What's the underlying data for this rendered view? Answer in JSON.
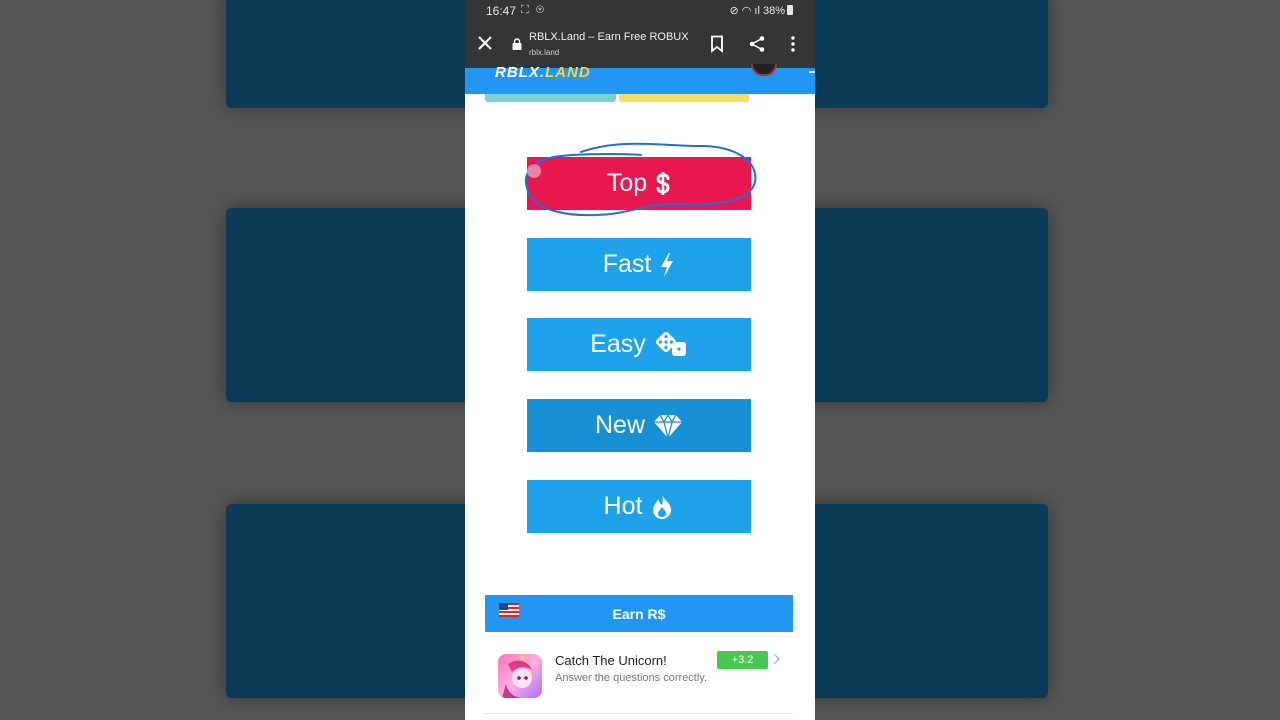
{
  "status_bar": {
    "time": "16:47",
    "notification_icons": "⛶ ⊛",
    "system": "⊘ ◠ ıl 38%"
  },
  "browser": {
    "page_title": "RBLX.Land – Earn Free ROBUX",
    "url": "rblx.land"
  },
  "site": {
    "logo_part1": "RBLX.",
    "logo_part2": "LAND"
  },
  "categories": [
    {
      "label": "Top",
      "icon": "dollar-icon",
      "color": "#e8174f"
    },
    {
      "label": "Fast",
      "icon": "bolt-icon",
      "color": "#1ea3ea"
    },
    {
      "label": "Easy",
      "icon": "dice-icon",
      "color": "#1ea3ea"
    },
    {
      "label": "New",
      "icon": "diamond-icon",
      "color": "#1790d6"
    },
    {
      "label": "Hot",
      "icon": "fire-icon",
      "color": "#1ea3ea"
    }
  ],
  "earn_section": {
    "title": "Earn R$",
    "flag": "us-flag-icon"
  },
  "offers": [
    {
      "title": "Catch The Unicorn!",
      "description": "Answer the questions correctly.",
      "reward": "+3.2"
    }
  ],
  "colors": {
    "accent_blue": "#2196f3",
    "button_blue": "#1ea3ea",
    "top_red": "#e8174f",
    "reward_green": "#47c84e"
  }
}
